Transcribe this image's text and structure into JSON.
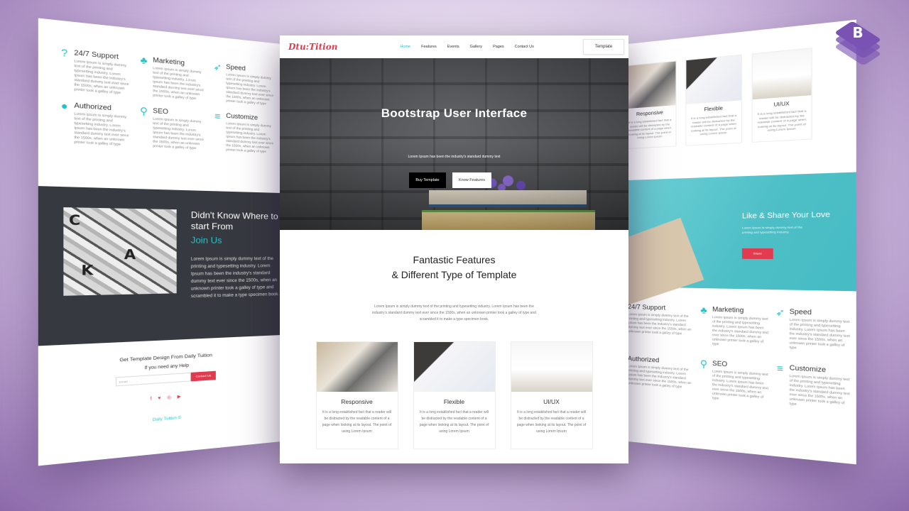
{
  "brand": {
    "logo": "Dtu:Tition",
    "accent": "#27c1c8",
    "red": "#e23a4e"
  },
  "nav": {
    "items": [
      "Home",
      "Features",
      "Events",
      "Gallery",
      "Pages",
      "Contact Us"
    ],
    "active": "Home",
    "cta": "Template"
  },
  "hero": {
    "title": "Bootstrap User Interface",
    "subtitle": "Lorem Ipsum has been the industry's standard dummy text",
    "btn_buy": "Buy Template",
    "btn_know": "Know Features"
  },
  "features": {
    "heading_line1": "Fantastic Features",
    "heading_line2": "& Different Type of Template",
    "desc": "Lorem Ipsum is simply dummy text of the printing and typesetting industry. Lorem Ipsum has been the industry's standard dummy text ever since the 1500s, when an unknown printer took a galley of type and scrambled it to make a type specimen book.",
    "cards": [
      {
        "title": "Responsive",
        "text": "It is a long established fact that a reader will be distracted by the readable content of a page when looking at its layout. The point of using Lorem Ipsum"
      },
      {
        "title": "Flexible",
        "text": "It is a long established fact that a reader will be distracted by the readable content of a page when looking at its layout. The point of using Lorem Ipsum"
      },
      {
        "title": "UI/UX",
        "text": "It is a long established fact that a reader will be distracted by the readable content of a page when looking at its layout. The point of using Lorem Ipsum"
      }
    ]
  },
  "left_page": {
    "features": [
      {
        "title": "24/7 Support",
        "icon": "question-icon"
      },
      {
        "title": "Marketing",
        "icon": "plant-icon"
      },
      {
        "title": "Speed",
        "icon": "rocket-icon"
      },
      {
        "title": "Authorized",
        "icon": "users-icon"
      },
      {
        "title": "SEO",
        "icon": "search-icon"
      },
      {
        "title": "Customize",
        "icon": "sliders-icon"
      }
    ],
    "feature_text": "Lorem Ipsum is simply dummy text of the printing and typesetting industry. Lorem Ipsum has been the industry's standard dummy text ever since the 1500s, when an unknown printer took a galley of type",
    "join": {
      "title_line1": "Didn't Know Where to",
      "title_line2": "start From",
      "link": "Join Us",
      "text": "Lorem Ipsum is simply dummy text of the printing and typesetting industry. Lorem Ipsum has been the industry's standard dummy text ever since the 1500s, when an unknown printer took a galley of type and scrambled it to make a type specimen book."
    },
    "footer": {
      "title": "Get Template Design From Daily Tuition",
      "sub": "If you need any Help",
      "email_placeholder": "Email",
      "contact_btn": "Contact Us",
      "socials": "f ♥ ◎ ▶",
      "copyright": "Daily Tuition ©"
    }
  },
  "right_page": {
    "cards": [
      {
        "title": "Responsive",
        "text": "It is a long established fact that a reader will be distracted by the readable content of a page when looking at its layout. The point of using Lorem Ipsum"
      },
      {
        "title": "Flexible",
        "text": "It is a long established fact that a reader will be distracted by the readable content of a page when looking at its layout. The point of using Lorem Ipsum"
      },
      {
        "title": "UI/UX",
        "text": "It is a long established fact that a reader will be distracted by the readable content of a page when looking at its layout. The point of using Lorem Ipsum"
      }
    ],
    "share": {
      "title": "Like & Share Your Love",
      "text": "Lorem Ipsum is simply dummy text of the printing and typesetting industry.",
      "btn": "Share"
    },
    "features": [
      {
        "title": "24/7 Support"
      },
      {
        "title": "Marketing"
      },
      {
        "title": "Speed"
      },
      {
        "title": "Authorized"
      },
      {
        "title": "SEO"
      },
      {
        "title": "Customize"
      }
    ]
  },
  "badge": {
    "letter": "B",
    "color": "#7952b3"
  }
}
